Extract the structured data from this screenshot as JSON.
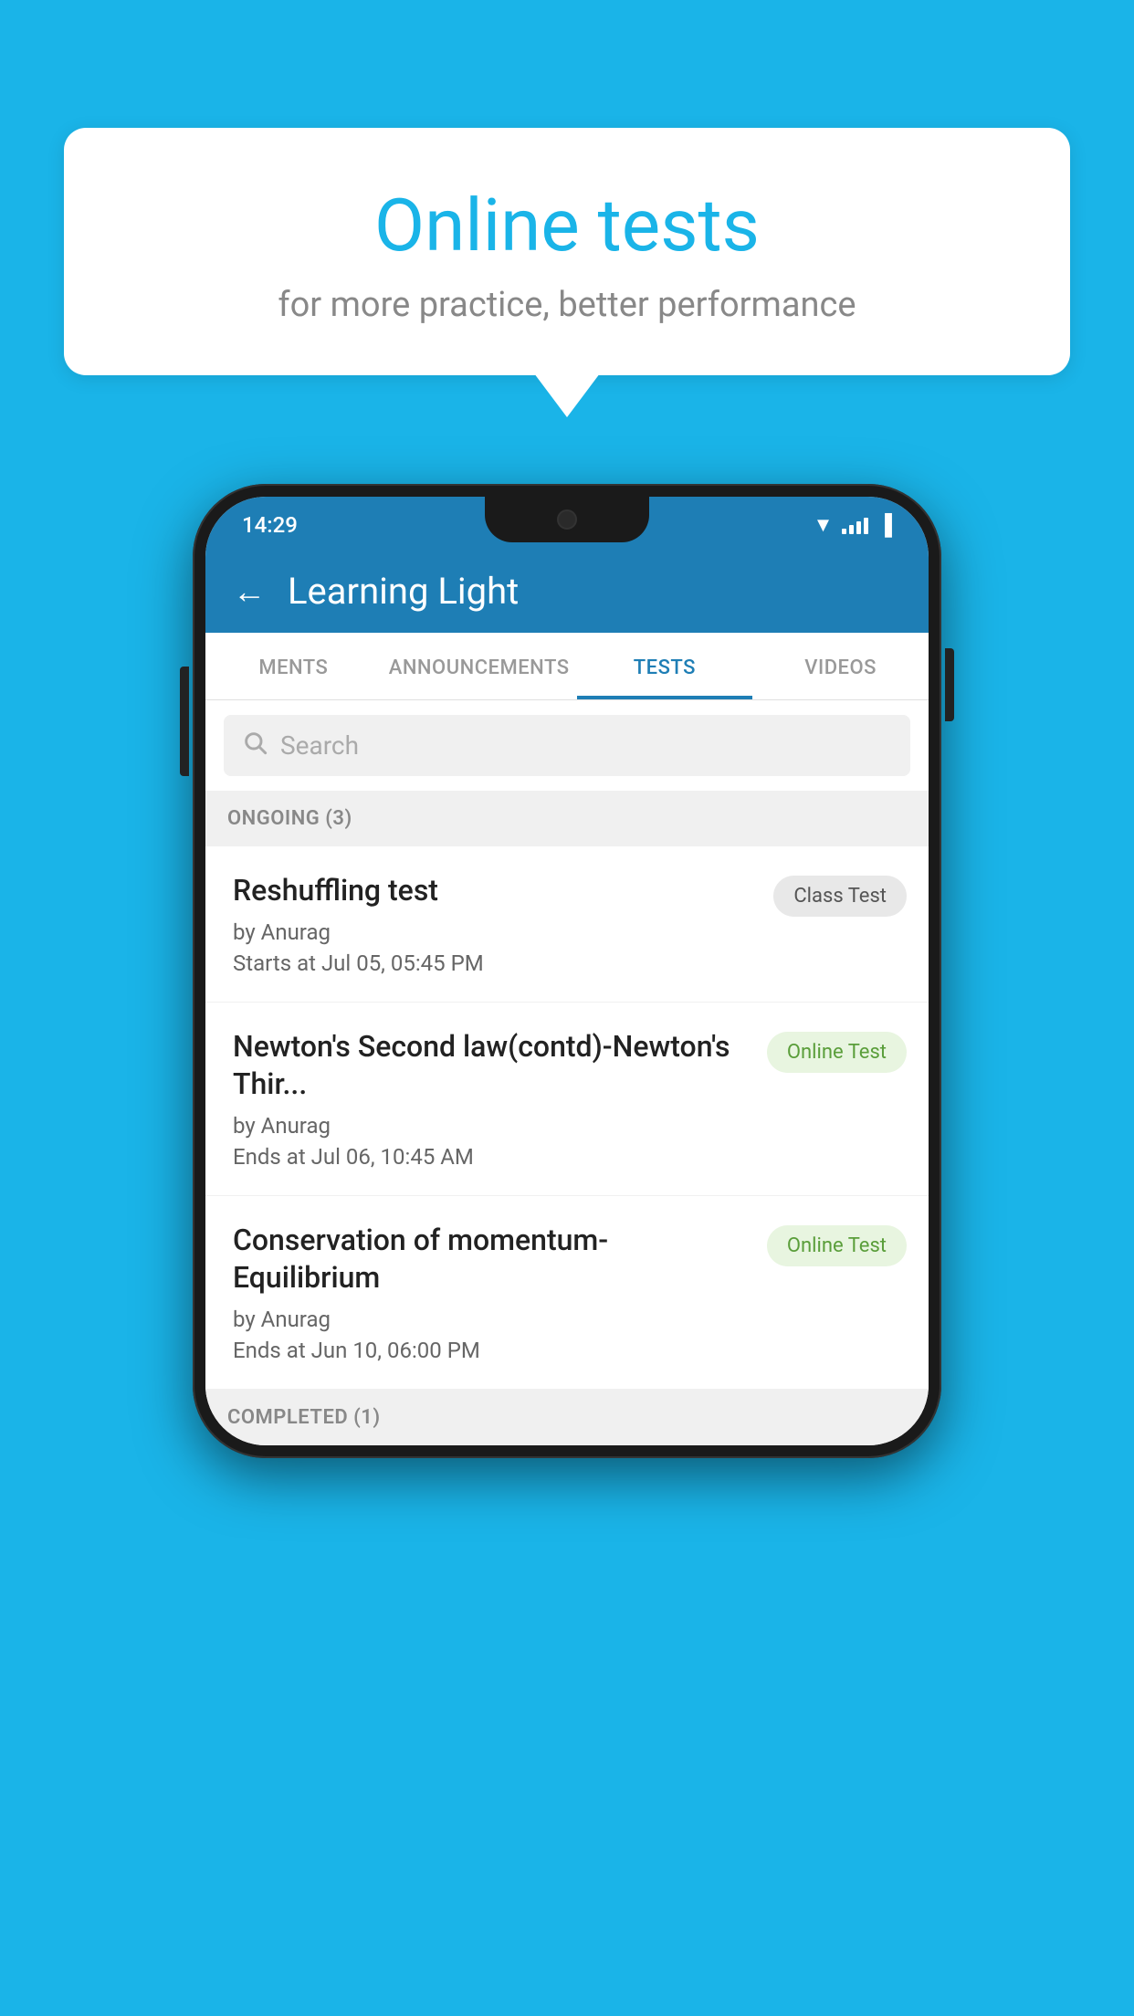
{
  "background": {
    "color": "#1ab4e8"
  },
  "speech_bubble": {
    "title": "Online tests",
    "subtitle": "for more practice, better performance"
  },
  "phone": {
    "status_bar": {
      "time": "14:29",
      "wifi": "▼",
      "signal": "▲",
      "battery": "▐"
    },
    "header": {
      "back_label": "←",
      "title": "Learning Light"
    },
    "tabs": [
      {
        "label": "MENTS",
        "active": false
      },
      {
        "label": "ANNOUNCEMENTS",
        "active": false
      },
      {
        "label": "TESTS",
        "active": true
      },
      {
        "label": "VIDEOS",
        "active": false
      }
    ],
    "search": {
      "placeholder": "Search"
    },
    "ongoing_section": {
      "label": "ONGOING (3)"
    },
    "tests": [
      {
        "name": "Reshuffling test",
        "author": "by Anurag",
        "date_label": "Starts at",
        "date": "Jul 05, 05:45 PM",
        "badge": "Class Test",
        "badge_type": "class"
      },
      {
        "name": "Newton's Second law(contd)-Newton's Thir...",
        "author": "by Anurag",
        "date_label": "Ends at",
        "date": "Jul 06, 10:45 AM",
        "badge": "Online Test",
        "badge_type": "online"
      },
      {
        "name": "Conservation of momentum-Equilibrium",
        "author": "by Anurag",
        "date_label": "Ends at",
        "date": "Jun 10, 06:00 PM",
        "badge": "Online Test",
        "badge_type": "online"
      }
    ],
    "completed_section": {
      "label": "COMPLETED (1)"
    }
  }
}
